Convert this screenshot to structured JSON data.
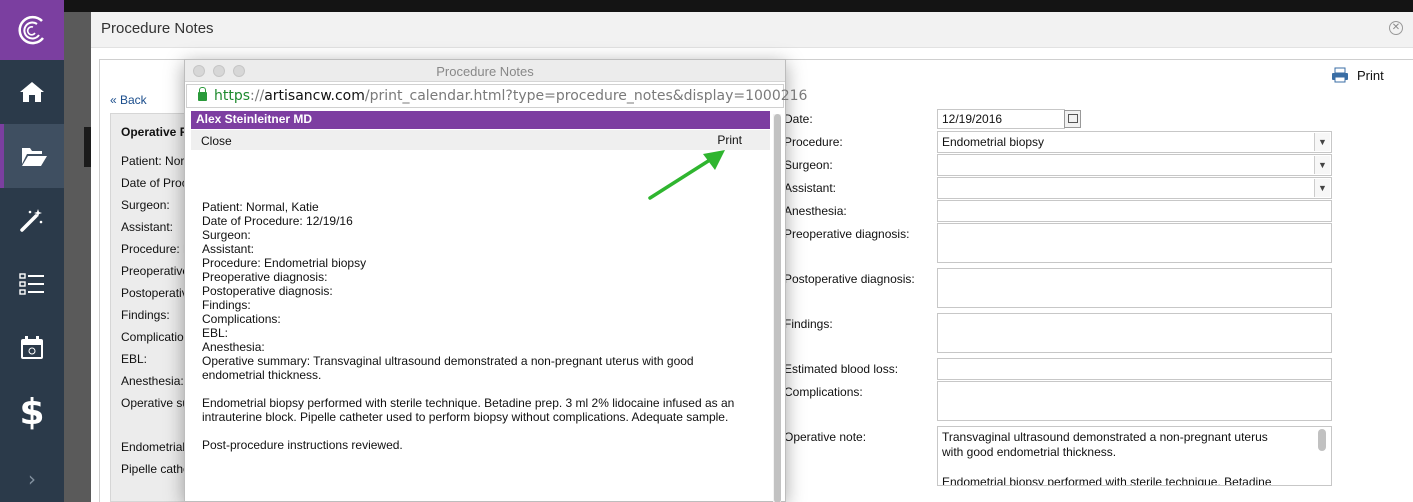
{
  "sidebar": {
    "items": [
      {
        "name": "home"
      },
      {
        "name": "folder-open"
      },
      {
        "name": "magic-wand"
      },
      {
        "name": "checklist"
      },
      {
        "name": "calendar"
      },
      {
        "name": "dollar"
      }
    ],
    "dollar_glyph": "$",
    "expand_glyph": "›"
  },
  "modal": {
    "title": "Procedure Notes",
    "back_label": "« Back",
    "print_label": "Print"
  },
  "left_panel": {
    "title": "Operative R",
    "lines": [
      "Patient: Nor",
      "Date of Proc",
      "Surgeon:",
      "Assistant:",
      "Procedure: E",
      "Preoperative",
      "Postoperativ",
      "Findings:",
      "Complication",
      "EBL:",
      "Anesthesia:",
      "Operative su",
      "Endometrial",
      "Pipelle cathe"
    ]
  },
  "form": {
    "date_label": "Date:",
    "date_value": "12/19/2016",
    "procedure_label": "Procedure:",
    "procedure_value": "Endometrial biopsy",
    "surgeon_label": "Surgeon:",
    "assistant_label": "Assistant:",
    "anesthesia_label": "Anesthesia:",
    "preop_label": "Preoperative diagnosis:",
    "postop_label": "Postoperative diagnosis:",
    "findings_label": "Findings:",
    "ebl_label": "Estimated blood loss:",
    "complications_label": "Complications:",
    "opnote_label": "Operative note:",
    "opnote_line1": "Transvaginal ultrasound demonstrated a non-pregnant uterus",
    "opnote_line2": "with good endometrial thickness.",
    "opnote_line3": "Endometrial biopsy performed with sterile technique. Betadine"
  },
  "popup": {
    "window_title": "Procedure Notes",
    "url_scheme": "https",
    "url_sep": "://",
    "url_host": "artisancw.com",
    "url_path": "/print_calendar.html?type=procedure_notes&display=1000216",
    "header_name": "Alex Steinleitner MD",
    "close_label": "Close",
    "print_label": "Print",
    "lines": [
      "Patient: Normal, Katie",
      "Date of Procedure: 12/19/16",
      "Surgeon:",
      "Assistant:",
      "Procedure: Endometrial biopsy",
      "Preoperative diagnosis:",
      "Postoperative diagnosis:",
      "Findings:",
      "Complications:",
      "EBL:",
      "Anesthesia:",
      "Operative summary: Transvaginal ultrasound demonstrated a non-pregnant uterus with good",
      "endometrial thickness."
    ],
    "para2_line1": "Endometrial biopsy performed with sterile technique. Betadine prep. 3 ml 2% lidocaine infused as an",
    "para2_line2": "intrauterine block. Pipelle catheter used to perform biopsy without complications. Adequate sample.",
    "para3": "Post-procedure instructions reviewed."
  },
  "colors": {
    "brand_purple": "#7b3fa0",
    "sidebar_bg": "#2b3a4a",
    "annotation_arrow": "#2fb52f",
    "secure_green": "#1e8a2e"
  }
}
